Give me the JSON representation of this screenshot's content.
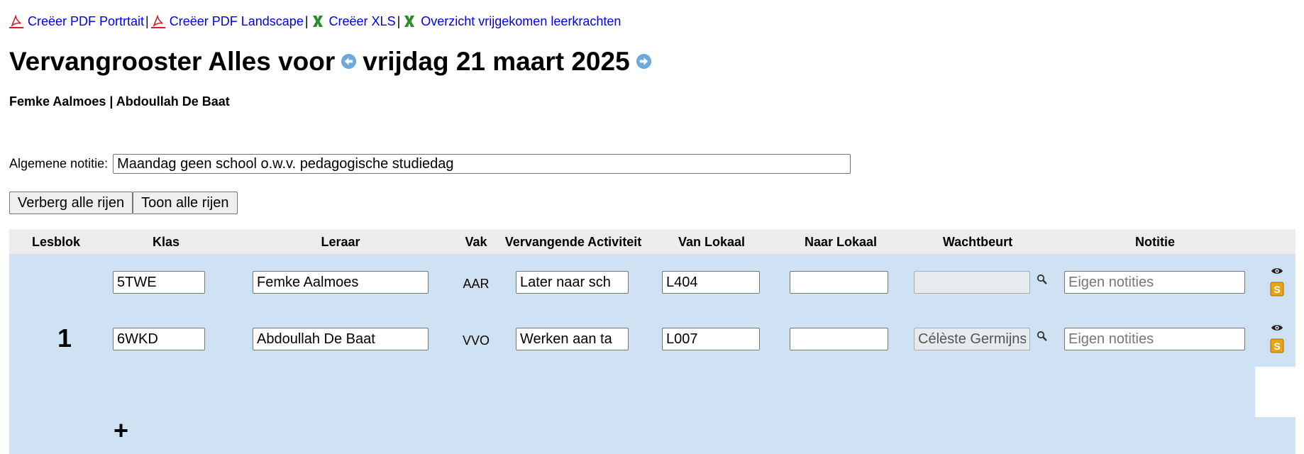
{
  "links": {
    "pdf_portrait": "Creëer PDF Portrtait",
    "pdf_landscape": "Creëer PDF Landscape",
    "xls": "Creëer XLS",
    "overview": "Overzicht vrijgekomen leerkrachten",
    "separator": "|"
  },
  "heading": {
    "prefix": "Vervangrooster Alles voor",
    "date": "vrijdag 21 maart 2025"
  },
  "teachers_line": "Femke Aalmoes | Abdoullah De Baat",
  "general_note": {
    "label": "Algemene notitie:",
    "value": "Maandag geen school o.w.v. pedagogische studiedag"
  },
  "buttons": {
    "hide_all": "Verberg alle rijen",
    "show_all": "Toon alle rijen"
  },
  "columns": {
    "lesblok": "Lesblok",
    "klas": "Klas",
    "leraar": "Leraar",
    "vak": "Vak",
    "activiteit": "Vervangende Activiteit",
    "van_lokaal": "Van Lokaal",
    "naar_lokaal": "Naar Lokaal",
    "wachtbeurt": "Wachtbeurt",
    "notitie": "Notitie"
  },
  "lesblok": "1",
  "rows": [
    {
      "klas": "5TWE",
      "leraar": "Femke Aalmoes",
      "vak": "AAR",
      "activiteit": "Later naar sch",
      "van_lokaal": "L404",
      "naar_lokaal": "",
      "wachtbeurt": "",
      "notitie_placeholder": "Eigen notities"
    },
    {
      "klas": "6WKD",
      "leraar": "Abdoullah De Baat",
      "vak": "VVO",
      "activiteit": "Werken aan ta",
      "van_lokaal": "L007",
      "naar_lokaal": "",
      "wachtbeurt": "Célèste Germijns",
      "notitie_placeholder": "Eigen notities"
    }
  ],
  "add_row_symbol": "+",
  "icons": [
    "pdf-icon",
    "pdf-icon",
    "excel-icon",
    "excel-icon",
    "arrow-left-circle-icon",
    "arrow-right-circle-icon",
    "search-icon",
    "eye-icon",
    "substitute-icon",
    "plus-icon"
  ],
  "colors": {
    "link": "#0000ee",
    "table_body": "#cfe2f3",
    "table_head": "#ececec",
    "arrow": "#6fa8dc",
    "excel": "#2e8b2e",
    "pdf": "#cc2222"
  }
}
